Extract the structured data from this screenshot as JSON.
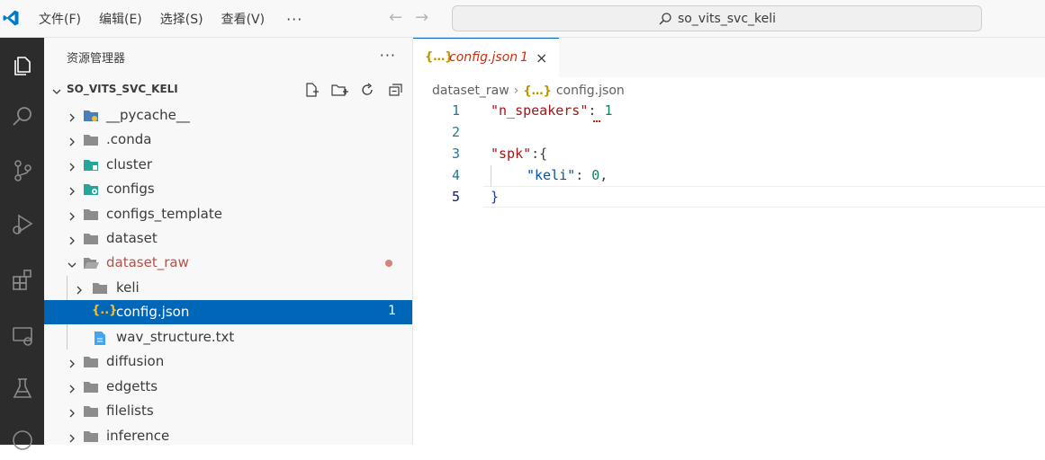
{
  "titlebar": {
    "menus": [
      "文件(F)",
      "编辑(E)",
      "选择(S)",
      "查看(V)"
    ],
    "more": "···",
    "search": "so_vits_svc_keli"
  },
  "sidebar": {
    "title": "资源管理器",
    "more": "···",
    "root": "SO_VITS_SVC_KELI",
    "items": [
      {
        "name": "__pycache__",
        "kind": "folder",
        "icon": "python-folder-icon",
        "depth": 0
      },
      {
        "name": ".conda",
        "kind": "folder",
        "icon": "folder-icon",
        "depth": 0
      },
      {
        "name": "cluster",
        "kind": "folder",
        "icon": "cluster-folder-icon",
        "depth": 0
      },
      {
        "name": "configs",
        "kind": "folder",
        "icon": "config-folder-icon",
        "depth": 0
      },
      {
        "name": "configs_template",
        "kind": "folder",
        "icon": "folder-icon",
        "depth": 0
      },
      {
        "name": "dataset",
        "kind": "folder",
        "icon": "folder-icon",
        "depth": 0
      },
      {
        "name": "dataset_raw",
        "kind": "folder-open",
        "icon": "folder-open-icon",
        "depth": 0
      },
      {
        "name": "keli",
        "kind": "folder",
        "icon": "folder-icon",
        "depth": 1
      },
      {
        "name": "config.json",
        "kind": "file",
        "icon": "json-file-icon",
        "depth": 1,
        "badge": "1"
      },
      {
        "name": "wav_structure.txt",
        "kind": "file",
        "icon": "text-file-icon",
        "depth": 1
      },
      {
        "name": "diffusion",
        "kind": "folder",
        "icon": "folder-icon",
        "depth": 0
      },
      {
        "name": "edgetts",
        "kind": "folder",
        "icon": "folder-icon",
        "depth": 0
      },
      {
        "name": "filelists",
        "kind": "folder",
        "icon": "folder-icon",
        "depth": 0
      },
      {
        "name": "inference",
        "kind": "folder",
        "icon": "folder-icon",
        "depth": 0
      }
    ]
  },
  "editor": {
    "tab": {
      "label": "config.json",
      "badge": "1",
      "close": "×",
      "icon": "{…}"
    },
    "breadcrumb": [
      "dataset_raw",
      "config.json"
    ],
    "line_numbers": [
      "1",
      "2",
      "3",
      "4",
      "5"
    ],
    "code": {
      "l1_key": "\"n_speakers\"",
      "l1_colon": ": ",
      "l1_val": "1",
      "l3_key": "\"spk\"",
      "l3_rest": ":{",
      "l4_key": "\"keli\"",
      "l4_colon": ": ",
      "l4_val": "0",
      "l4_comma": ",",
      "l5": "}"
    }
  },
  "colors": {
    "accent": "#0066b8",
    "activitybar": "#2c2c2c",
    "json_key": "#a31515",
    "number": "#098658"
  }
}
